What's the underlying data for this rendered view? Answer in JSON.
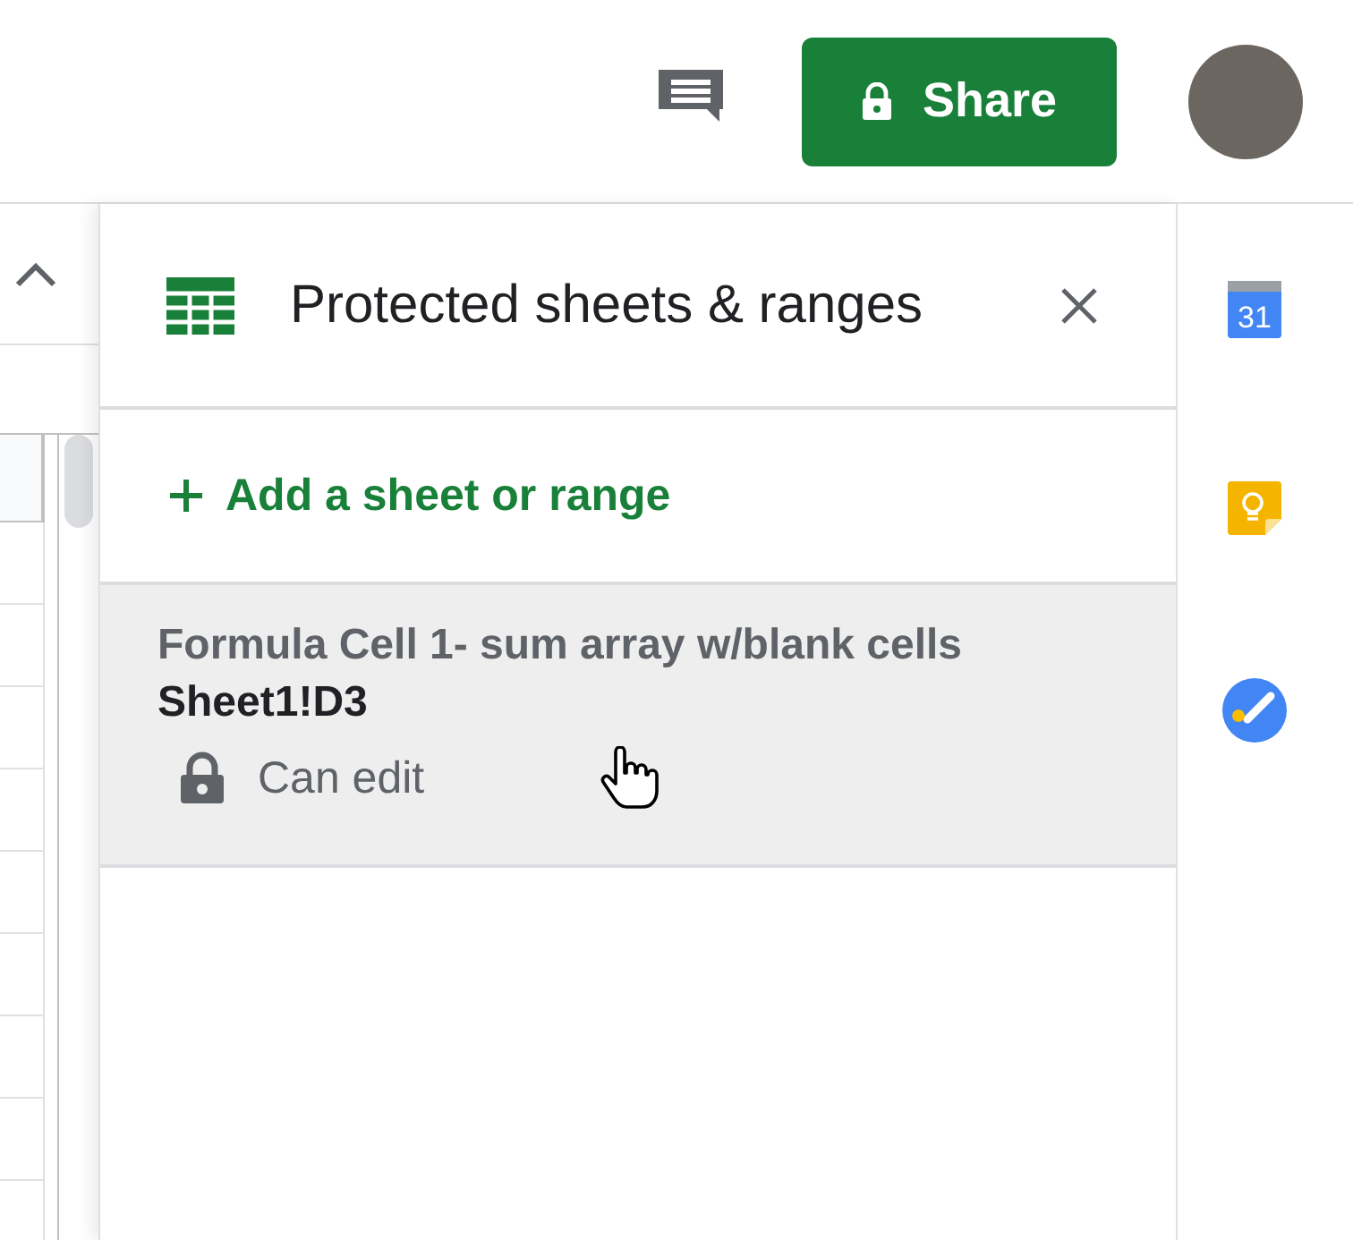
{
  "top_bar": {
    "share_button": {
      "label": "Share"
    }
  },
  "panel": {
    "title": "Protected sheets & ranges",
    "add_link": "Add a sheet or range",
    "calendar_day": "31",
    "items": [
      {
        "description": "Formula Cell 1- sum array w/blank cells",
        "range": "Sheet1!D3",
        "permission": "Can edit"
      }
    ]
  }
}
